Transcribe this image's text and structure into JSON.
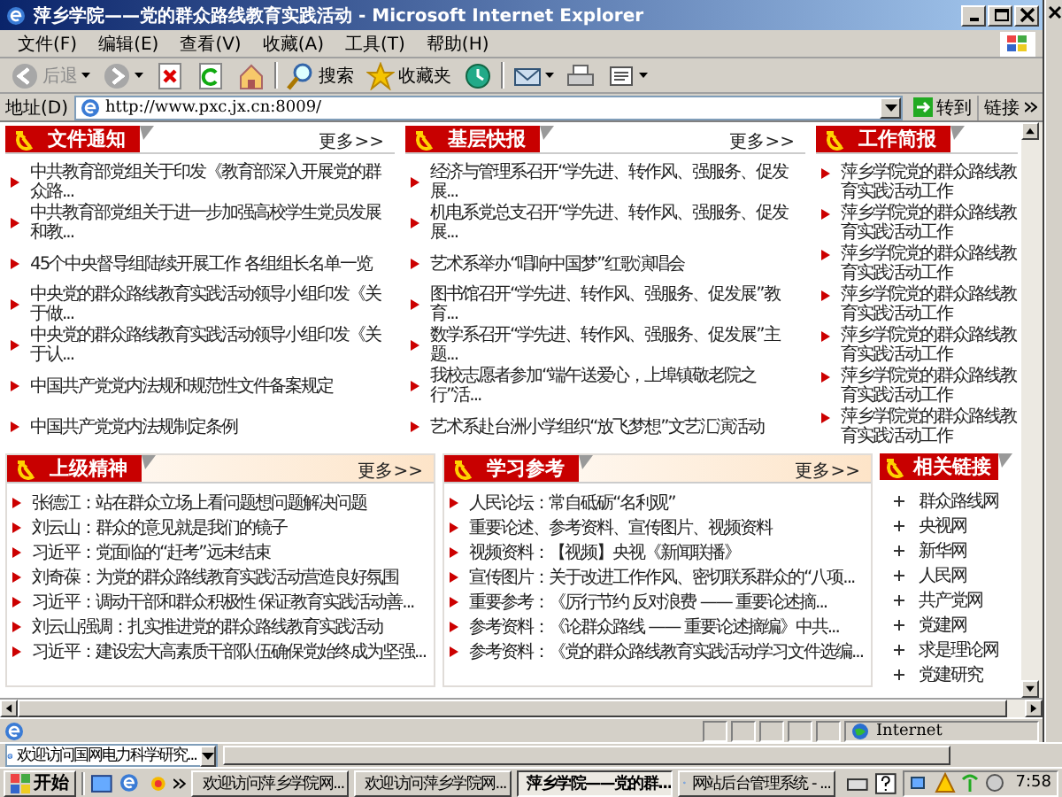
{
  "window": {
    "title": "萍乡学院——党的群众路线教育实践活动 - Microsoft Internet Explorer"
  },
  "menu": [
    "文件(F)",
    "编辑(E)",
    "查看(V)",
    "收藏(A)",
    "工具(T)",
    "帮助(H)"
  ],
  "toolbar": [
    {
      "kind": "back",
      "label": "后退",
      "disabled": true
    },
    {
      "kind": "forward",
      "disabled": true
    },
    {
      "kind": "stop",
      "disabled": false
    },
    {
      "kind": "refresh",
      "disabled": false
    },
    {
      "kind": "home",
      "disabled": false
    },
    {
      "kind": "search",
      "label": "搜索",
      "disabled": false
    },
    {
      "kind": "favorites",
      "label": "收藏夹",
      "disabled": false
    },
    {
      "kind": "history",
      "disabled": false
    },
    {
      "kind": "mail",
      "disabled": false
    },
    {
      "kind": "print",
      "disabled": false
    },
    {
      "kind": "edit",
      "disabled": false
    }
  ],
  "address": {
    "label": "地址(D)",
    "value": "http://www.pxc.jx.cn:8009/",
    "go": "转到",
    "links": "链接"
  },
  "top_sections": [
    {
      "title": "文件通知",
      "more": "更多>>",
      "items": [
        "中共教育部党组关于印发《教育部深入开展党的群众路...",
        "中共教育部党组关于进一步加强高校学生党员发展和教...",
        "45个中央督导组陆续开展工作 各组组长名单一览",
        "中央党的群众路线教育实践活动领导小组印发《关于做...",
        "中央党的群众路线教育实践活动领导小组印发《关于认...",
        "中国共产党党内法规和规范性文件备案规定",
        "中国共产党党内法规制定条例"
      ]
    },
    {
      "title": "基层快报",
      "more": "更多>>",
      "items": [
        "经济与管理系召开“学先进、转作风、强服务、促发展...",
        "机电系党总支召开“学先进、转作风、强服务、促发展...",
        "艺术系举办“唱响中国梦”红歌演唱会",
        "图书馆召开“学先进、转作风、强服务、促发展”教育...",
        "数学系召开“学先进、转作风、强服务、促发展”主题...",
        "我校志愿者参加“端午送爱心，上埠镇敬老院之行”活...",
        "艺术系赴台洲小学组织“放飞梦想”文艺汇演活动"
      ]
    },
    {
      "title": "工作简报",
      "items": [
        "萍乡学院党的群众路线教育实践活动工作",
        "萍乡学院党的群众路线教育实践活动工作",
        "萍乡学院党的群众路线教育实践活动工作",
        "萍乡学院党的群众路线教育实践活动工作",
        "萍乡学院党的群众路线教育实践活动工作",
        "萍乡学院党的群众路线教育实践活动工作",
        "萍乡学院党的群众路线教育实践活动工作"
      ]
    }
  ],
  "lower_sections": [
    {
      "title": "上级精神",
      "more": "更多>>",
      "items": [
        "张德江：站在群众立场上看问题想问题解决问题",
        "刘云山：群众的意见就是我们的镜子",
        "习近平：党面临的“赶考”远未结束",
        "刘奇葆：为党的群众路线教育实践活动营造良好氛围",
        "习近平：调动干部和群众积极性 保证教育实践活动善...",
        "刘云山强调：扎实推进党的群众路线教育实践活动",
        "习近平：建设宏大高素质干部队伍确保党始终成为坚强..."
      ]
    },
    {
      "title": "学习参考",
      "more": "更多>>",
      "items": [
        "人民论坛：常自砥砺“名利观”",
        "重要论述、参考资料、宣传图片、视频资料",
        "视频资料：【视频】央视《新闻联播》",
        "宣传图片：关于改进工作作风、密切联系群众的“八项...",
        "重要参考：《厉行节约 反对浪费 —— 重要论述摘...",
        "参考资料：《论群众路线 —— 重要论述摘编》中共...",
        "参考资料：《党的群众路线教育实践活动学习文件选编..."
      ]
    }
  ],
  "related_links": {
    "title": "相关链接",
    "items": [
      "群众路线网",
      "央视网",
      "新华网",
      "人民网",
      "共产党网",
      "党建网",
      "求是理论网",
      "党建研究"
    ]
  },
  "status_bar": {
    "zone": "Internet"
  },
  "background_window": {
    "field": "欢迎访问国网电力科学研究..."
  },
  "taskbar": {
    "start": "开始",
    "tasks": [
      {
        "label": "欢迎访问萍乡学院网...",
        "selected": false
      },
      {
        "label": "欢迎访问萍乡学院网...",
        "selected": false
      },
      {
        "label": "萍乡学院——党的群...",
        "selected": true
      },
      {
        "label": "网站后台管理系统 - ...",
        "selected": false
      }
    ],
    "clock": "7:58"
  }
}
